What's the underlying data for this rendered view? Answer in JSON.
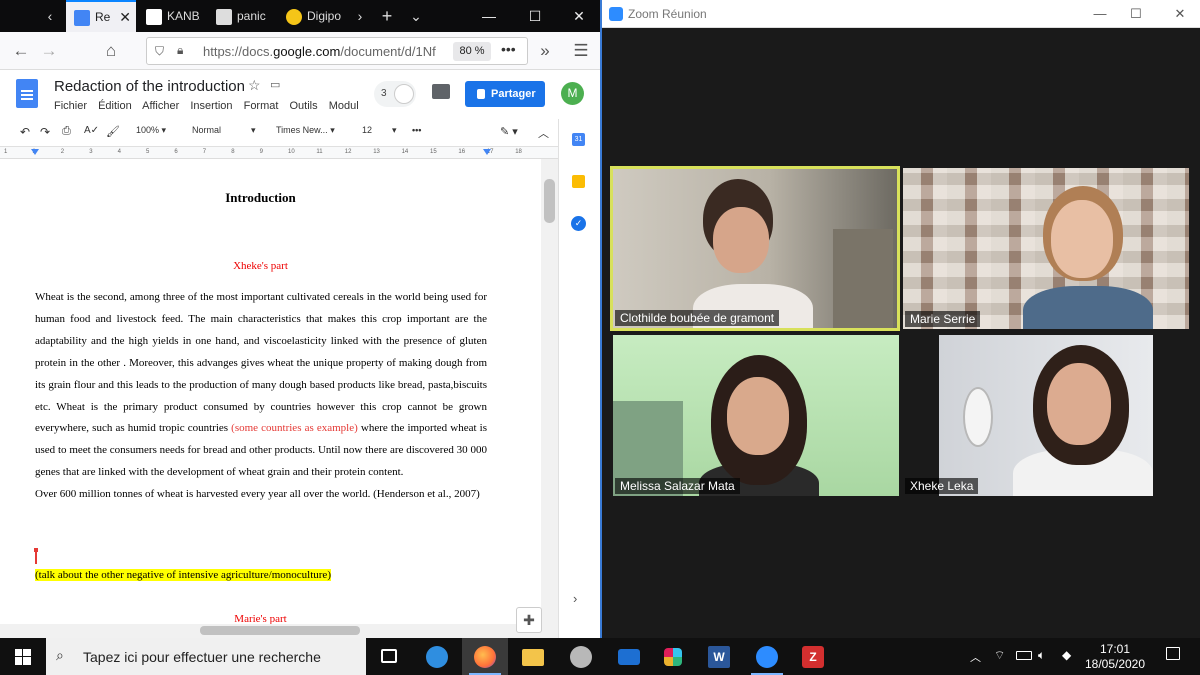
{
  "firefox": {
    "tabs": [
      {
        "label": "Re",
        "active": true
      },
      {
        "label": "KANBA",
        "active": false
      },
      {
        "label": "panic",
        "active": false
      },
      {
        "label": "Digipo",
        "active": false
      }
    ],
    "url_prefix": "https://docs.",
    "url_domain": "google.com",
    "url_rest": "/document/d/1Nf",
    "zoom": "80 %"
  },
  "docs": {
    "title": "Redaction of the introduction",
    "menu": [
      "Fichier",
      "Édition",
      "Afficher",
      "Insertion",
      "Format",
      "Outils",
      "Modul"
    ],
    "viewer_count": "3",
    "share_label": "Partager",
    "user_initial": "M",
    "toolbar": {
      "zoom": "100%",
      "style": "Normal",
      "font": "Times New...",
      "size": "12"
    },
    "ruler_numbers": [
      "1",
      "1",
      "2",
      "3",
      "4",
      "5",
      "6",
      "7",
      "8",
      "9",
      "10",
      "11",
      "12",
      "13",
      "14",
      "15",
      "16",
      "17",
      "18"
    ],
    "heading": "Introduction",
    "section_1": "Xheke's part",
    "paragraph_part1": "Wheat is the second, among  three of the most important cultivated cereals in the world being used for human food and livestock feed. The main characteristics that makes this crop important are the adaptability and the high yields in one hand, and viscoelasticity linked with the presence of gluten protein in the other . Moreover, this advanges gives wheat the unique property of making dough from its grain flour and this leads to the production of many dough based products like bread, pasta,biscuits etc. Wheat is the primary product consumed by countries however this crop cannot be grown everywhere, such as humid tropic countries ",
    "paragraph_red": "(some countries as example)",
    "paragraph_part2": " where  the imported  wheat is used to meet the consumers needs for bread and other products. Until now there are discovered 30 000 genes that are linked with the development of wheat grain and their protein content.",
    "paragraph_2": "Over 600 million tonnes of wheat is harvested every year all over the world. (Henderson et al., 2007)",
    "highlight_note": "(talk about the other negative of intensive agriculture/monoculture)",
    "section_2": "Marie's part"
  },
  "zoom": {
    "window_title": "Zoom Réunion",
    "participants": [
      {
        "name": "Clothilde boubée de gramont",
        "active_speaker": true
      },
      {
        "name": "Marie Serrie",
        "active_speaker": false
      },
      {
        "name": "Melissa Salazar Mata",
        "active_speaker": false
      },
      {
        "name": "Xheke Leka",
        "active_speaker": false
      }
    ]
  },
  "taskbar": {
    "search_placeholder": "Tapez ici pour effectuer une recherche",
    "time": "17:01",
    "date": "18/05/2020"
  },
  "colors": {
    "docs_blue": "#1a73e8",
    "active_speaker_border": "#d8e15b",
    "doc_red": "#e53935",
    "highlight": "#ffff00"
  }
}
